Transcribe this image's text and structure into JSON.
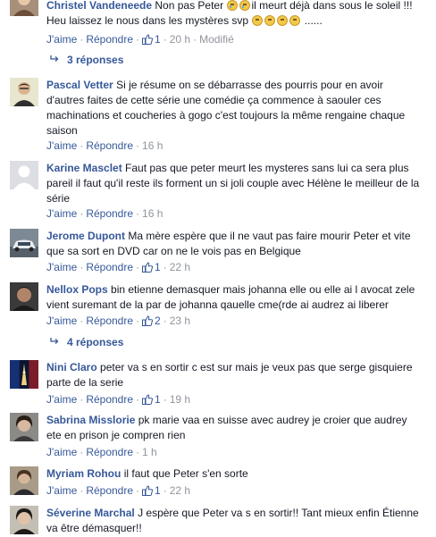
{
  "ui": {
    "like_label": "J'aime",
    "reply_label": "Répondre",
    "separator": "·"
  },
  "comments": [
    {
      "name": "Christel Vandeneede",
      "text_a": "Non pas Peter ",
      "text_b": "il meurt déjà dans sous le soleil !!! Heu laissez le nous dans les mystères svp ",
      "text_c": " ......",
      "likes": "1",
      "time": "20 h",
      "modified": "Modifié",
      "replies": "3 réponses"
    },
    {
      "name": "Pascal Vetter",
      "text": "Si je résume on se débarrasse des pourris pour en avoir d'autres faites de cette série une comédie ça commence à saouler ces machinations et coucheries à gogo c'est toujours la même rengaine chaque saison",
      "time": "16 h"
    },
    {
      "name": "Karine Masclet",
      "text": "Faut pas que peter meurt les mysteres sans lui ca sera plus pareil il faut qu'il reste ils forment un si joli couple avec Hélène le meilleur de la série",
      "time": "16 h"
    },
    {
      "name": "Jerome Dupont",
      "text": "Ma mère espère que il ne vaut pas faire mourir Peter et vite que sa sort en DVD car on ne le vois pas en Belgique",
      "likes": "1",
      "time": "22 h"
    },
    {
      "name": "Nellox Pops",
      "text": "bin etienne demasquer mais johanna elle ou elle ai l avocat zele vient suremant de la par de johanna qauelle cme(rde ai audrez ai liberer",
      "likes": "2",
      "time": "23 h",
      "replies": "4 réponses"
    },
    {
      "name": "Nini Claro",
      "text": "peter va s en sortir c est sur mais je veux pas que serge gisquiere parte de la serie",
      "likes": "1",
      "time": "19 h"
    },
    {
      "name": "Sabrina Misslorie",
      "text": "pk marie vaa en suisse avec audrey je croier que audrey ete en prison je compren rien",
      "time": "1 h"
    },
    {
      "name": "Myriam Rohou",
      "text": "il faut que Peter s'en sorte",
      "likes": "1",
      "time": "22 h"
    },
    {
      "name": "Séverine Marchal",
      "text": "J espère que Peter va s en sortir!! Tant mieux enfin Étienne va être démasquer!!"
    }
  ],
  "colors": {
    "link": "#365899",
    "meta": "#90949c",
    "text": "#141823"
  }
}
